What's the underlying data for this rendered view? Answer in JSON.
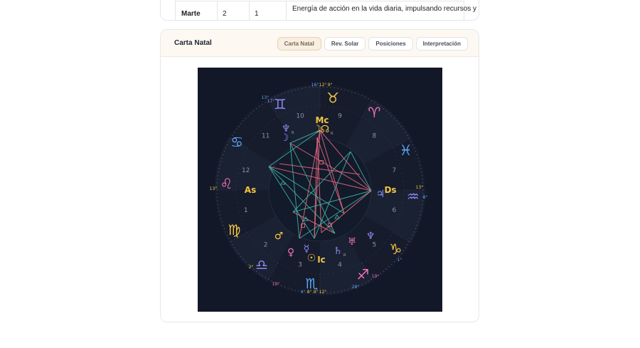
{
  "table_row": {
    "planet": "Marte",
    "col2": "2",
    "col3": "1",
    "description": "Energía de acción en la vida diaria, impulsando recursos y"
  },
  "chart_card": {
    "title": "Carta Natal",
    "tabs": [
      {
        "label": "Carta Natal",
        "active": true
      },
      {
        "label": "Rev. Solar",
        "active": false
      },
      {
        "label": "Posiciones",
        "active": false
      },
      {
        "label": "Interpretación",
        "active": false
      }
    ]
  },
  "wheel": {
    "colors": {
      "background": "#121828",
      "fire": "#f472b6",
      "earth": "#f5c542",
      "air": "#8b8cf5",
      "water": "#60a5fa",
      "grid": "#3d4458",
      "trine": "#3fb8a8",
      "square": "#f06b85"
    },
    "signs": [
      {
        "glyph": "♉",
        "name": "taurus",
        "element": "earth",
        "degrees": [
          "16°",
          "12°",
          "9°"
        ]
      },
      {
        "glyph": "♈",
        "name": "aries",
        "element": "fire"
      },
      {
        "glyph": "♓",
        "name": "pisces",
        "element": "water"
      },
      {
        "glyph": "♒",
        "name": "aquarius",
        "element": "air",
        "degrees": [
          "13°",
          "8°"
        ]
      },
      {
        "glyph": "♑",
        "name": "capricorn",
        "element": "earth",
        "degrees": [
          "1°"
        ]
      },
      {
        "glyph": "♐",
        "name": "sagittarius",
        "element": "fire",
        "degrees": [
          "19°",
          "28°"
        ]
      },
      {
        "glyph": "♏",
        "name": "scorpio",
        "element": "water",
        "degrees": [
          "4°",
          "8°",
          "9°",
          "12°"
        ]
      },
      {
        "glyph": "♎",
        "name": "libra",
        "element": "air",
        "degrees": [
          "19°"
        ]
      },
      {
        "glyph": "♍",
        "name": "virgo",
        "element": "earth",
        "degrees": [
          "2°"
        ]
      },
      {
        "glyph": "♌",
        "name": "leo",
        "element": "fire",
        "degrees": [
          "13°"
        ]
      },
      {
        "glyph": "♋",
        "name": "cancer",
        "element": "water"
      },
      {
        "glyph": "♊",
        "name": "gemini",
        "element": "air",
        "degrees": [
          "13°",
          "17°"
        ]
      }
    ],
    "houses": [
      "1",
      "2",
      "3",
      "4",
      "5",
      "6",
      "7",
      "8",
      "9",
      "10",
      "11",
      "12"
    ],
    "angles": {
      "asc": "As",
      "dsc": "Ds",
      "mc": "Mc",
      "ic": "Ic"
    },
    "planets": [
      {
        "glyph": "☽",
        "name": "moon",
        "color": "#f5c542"
      },
      {
        "glyph": "☊",
        "name": "node",
        "color": "#f5c542",
        "retro": "R"
      },
      {
        "glyph": "♆",
        "name": "neptune",
        "color": "#8b8cf5",
        "retro": "R"
      },
      {
        "glyph": "☽",
        "name": "moon-dark",
        "color": "#8b8cf5"
      },
      {
        "glyph": "♃",
        "name": "jupiter",
        "color": "#8b8cf5"
      },
      {
        "glyph": "♂",
        "name": "mars",
        "color": "#f5c542"
      },
      {
        "glyph": "♀",
        "name": "venus",
        "color": "#f472b6"
      },
      {
        "glyph": "☿",
        "name": "mercury",
        "color": "#8b8cf5"
      },
      {
        "glyph": "☉",
        "name": "sun",
        "color": "#f5c542"
      },
      {
        "glyph": "♄",
        "name": "saturn",
        "color": "#8b8cf5",
        "retro": "R"
      },
      {
        "glyph": "♅",
        "name": "uranus",
        "color": "#f472b6"
      },
      {
        "glyph": "♆",
        "name": "neptune-2",
        "color": "#8b8cf5"
      }
    ]
  }
}
